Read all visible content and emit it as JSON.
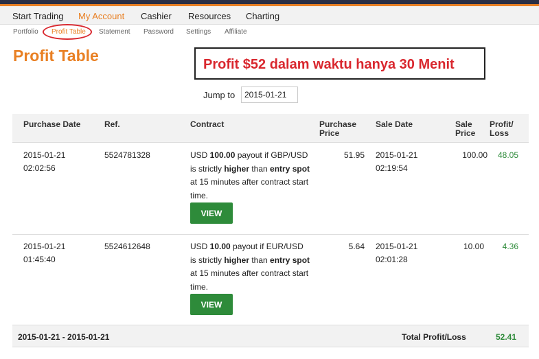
{
  "main_nav": [
    {
      "label": "Start Trading",
      "active": false
    },
    {
      "label": "My Account",
      "active": true
    },
    {
      "label": "Cashier",
      "active": false
    },
    {
      "label": "Resources",
      "active": false
    },
    {
      "label": "Charting",
      "active": false
    }
  ],
  "sub_nav": [
    {
      "label": "Portfolio",
      "active": false
    },
    {
      "label": "Profit Table",
      "active": true
    },
    {
      "label": "Statement",
      "active": false
    },
    {
      "label": "Password",
      "active": false
    },
    {
      "label": "Settings",
      "active": false
    },
    {
      "label": "Affiliate",
      "active": false
    }
  ],
  "page_title": "Profit Table",
  "banner_text": "Profit $52 dalam waktu hanya 30 Menit",
  "jump": {
    "label": "Jump to",
    "value": "2015-01-21"
  },
  "table": {
    "columns": {
      "purchase_date": "Purchase Date",
      "ref": "Ref.",
      "contract": "Contract",
      "purchase_price": [
        "Purchase",
        "Price"
      ],
      "sale_date": "Sale Date",
      "sale_price": [
        "Sale",
        "Price"
      ],
      "profit_loss": [
        "Profit/",
        "Loss"
      ]
    },
    "rows": [
      {
        "purchase_date": "2015-01-21",
        "purchase_time": "02:02:56",
        "ref": "5524781328",
        "contract": {
          "p1": "USD ",
          "amount": "100.00",
          "p2": " payout if GBP/USD is strictly ",
          "direction": "higher",
          "p3": " than ",
          "spot": "entry spot",
          "p4": " at 15 minutes after contract start time."
        },
        "purchase_price": "51.95",
        "sale_date": "2015-01-21",
        "sale_time": "02:19:54",
        "sale_price": "100.00",
        "profit_loss": "48.05",
        "view_label": "VIEW"
      },
      {
        "purchase_date": "2015-01-21",
        "purchase_time": "01:45:40",
        "ref": "5524612648",
        "contract": {
          "p1": "USD ",
          "amount": "10.00",
          "p2": " payout if EUR/USD is strictly ",
          "direction": "higher",
          "p3": " than ",
          "spot": "entry spot",
          "p4": " at 15 minutes after contract start time."
        },
        "purchase_price": "5.64",
        "sale_date": "2015-01-21",
        "sale_time": "02:01:28",
        "sale_price": "10.00",
        "profit_loss": "4.36",
        "view_label": "VIEW"
      }
    ],
    "footer": {
      "range": "2015-01-21 - 2015-01-21",
      "total_label": "Total Profit/Loss",
      "total_value": "52.41"
    }
  },
  "colors": {
    "accent": "#e98024",
    "profit_green": "#2e8b3a",
    "banner_red": "#d9272e",
    "header_dark": "#2a2f45"
  }
}
